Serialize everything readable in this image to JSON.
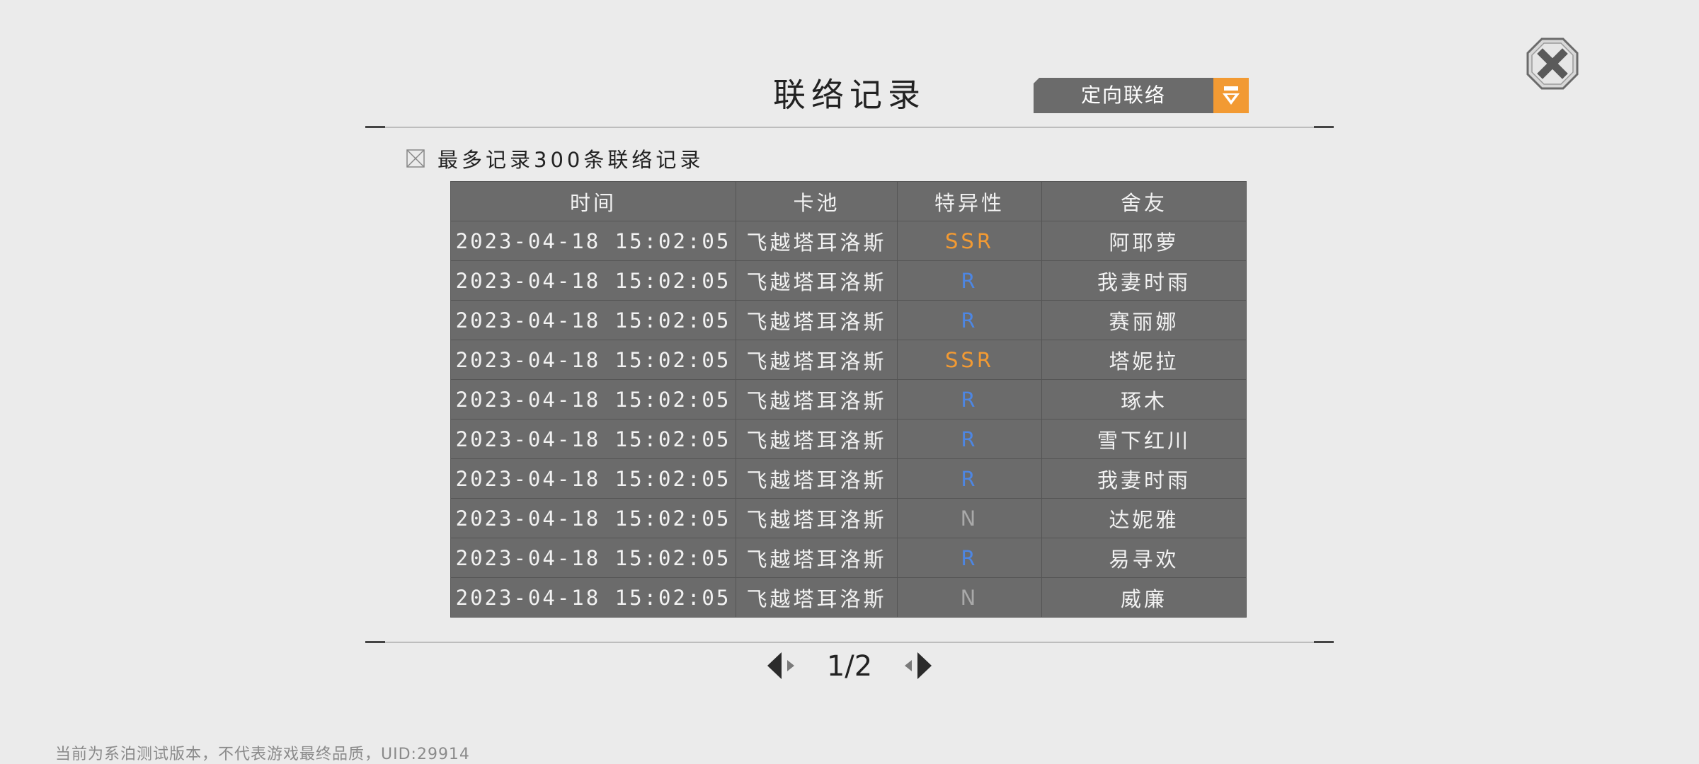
{
  "header": {
    "title": "联络记录",
    "dropdown_label": "定向联络"
  },
  "limit_note": "最多记录300条联络记录",
  "table": {
    "columns": [
      "时间",
      "卡池",
      "特异性",
      "舍友"
    ],
    "rows": [
      {
        "time": "2023-04-18 15:02:05",
        "pool": "飞越塔耳洛斯",
        "rarity": "SSR",
        "roommate": "阿耶萝"
      },
      {
        "time": "2023-04-18 15:02:05",
        "pool": "飞越塔耳洛斯",
        "rarity": "R",
        "roommate": "我妻时雨"
      },
      {
        "time": "2023-04-18 15:02:05",
        "pool": "飞越塔耳洛斯",
        "rarity": "R",
        "roommate": "赛丽娜"
      },
      {
        "time": "2023-04-18 15:02:05",
        "pool": "飞越塔耳洛斯",
        "rarity": "SSR",
        "roommate": "塔妮拉"
      },
      {
        "time": "2023-04-18 15:02:05",
        "pool": "飞越塔耳洛斯",
        "rarity": "R",
        "roommate": "琢木"
      },
      {
        "time": "2023-04-18 15:02:05",
        "pool": "飞越塔耳洛斯",
        "rarity": "R",
        "roommate": "雪下红川"
      },
      {
        "time": "2023-04-18 15:02:05",
        "pool": "飞越塔耳洛斯",
        "rarity": "R",
        "roommate": "我妻时雨"
      },
      {
        "time": "2023-04-18 15:02:05",
        "pool": "飞越塔耳洛斯",
        "rarity": "N",
        "roommate": "达妮雅"
      },
      {
        "time": "2023-04-18 15:02:05",
        "pool": "飞越塔耳洛斯",
        "rarity": "R",
        "roommate": "易寻欢"
      },
      {
        "time": "2023-04-18 15:02:05",
        "pool": "飞越塔耳洛斯",
        "rarity": "N",
        "roommate": "威廉"
      }
    ]
  },
  "pager": {
    "page_label": "1/2"
  },
  "footer": "当前为系泊测试版本，不代表游戏最终品质，UID:29914",
  "icons": {
    "close": "close-icon",
    "dropdown": "chevron-down-icon",
    "checkbox": "checkbox-icon",
    "prev": "prev-page-icon",
    "next": "next-page-icon"
  },
  "colors": {
    "SSR": "#f29a33",
    "R": "#4d86e3",
    "N": "#a9a9a9",
    "accent": "#f29a33",
    "panel": "#6b6b6b"
  }
}
